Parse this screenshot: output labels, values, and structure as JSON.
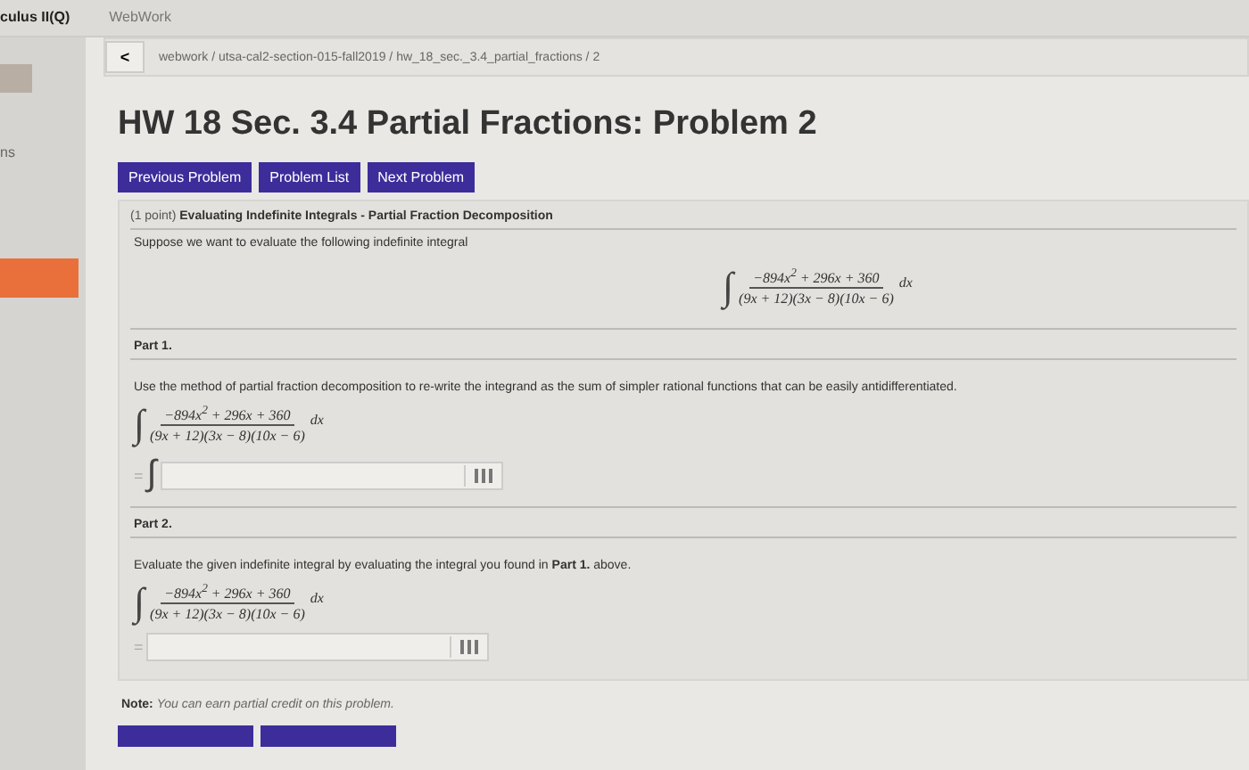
{
  "browser_tabs": [
    {
      "label": "culus II(Q)",
      "selected": true
    },
    {
      "label": "WebWork",
      "selected": false
    }
  ],
  "sidebar": {
    "label": "ns"
  },
  "breadcrumb": {
    "back": "<",
    "path": "webwork / utsa-cal2-section-015-fall2019 / hw_18_sec._3.4_partial_fractions / 2"
  },
  "title": "HW 18 Sec. 3.4 Partial Fractions: Problem 2",
  "nav_buttons": [
    "Previous Problem",
    "Problem List",
    "Next Problem"
  ],
  "problem": {
    "points": "(1 point)",
    "heading": "Evaluating Indefinite Integrals - Partial Fraction Decomposition",
    "intro": "Suppose we want to evaluate the following indefinite integral"
  },
  "integrals": [
    {
      "sign": "∫",
      "numerator": "−894x$^{2}$ + 296x + 360",
      "denominator": "(9x + 12)(3x − 8)(10x − 6)",
      "dx": "dx"
    },
    {
      "sign": "∫",
      "numerator": "−894x$^{2}$ + 296x + 360",
      "denominator": "(9x + 12)(3x − 8)(10x − 6)",
      "dx": "dx"
    },
    {
      "sign": "∫",
      "numerator": "−894x$^{2}$ + 296x + 360",
      "denominator": "(9x + 12)(3x − 8)(10x − 6)",
      "dx": "dx"
    }
  ],
  "parts": [
    {
      "label": "Part 1.",
      "text": "Use the method of partial fraction decomposition to re-write the integrand as the sum of simpler rational functions that can be easily antidifferentiated.",
      "equals": "=",
      "answer_sign": "∫"
    },
    {
      "label": "Part 2.",
      "text": "Evaluate the given indefinite integral by evaluating the integral you found in **Part 1.** above.",
      "equals": "="
    }
  ],
  "note": "**Note:** *You can earn partial credit on this problem.*"
}
